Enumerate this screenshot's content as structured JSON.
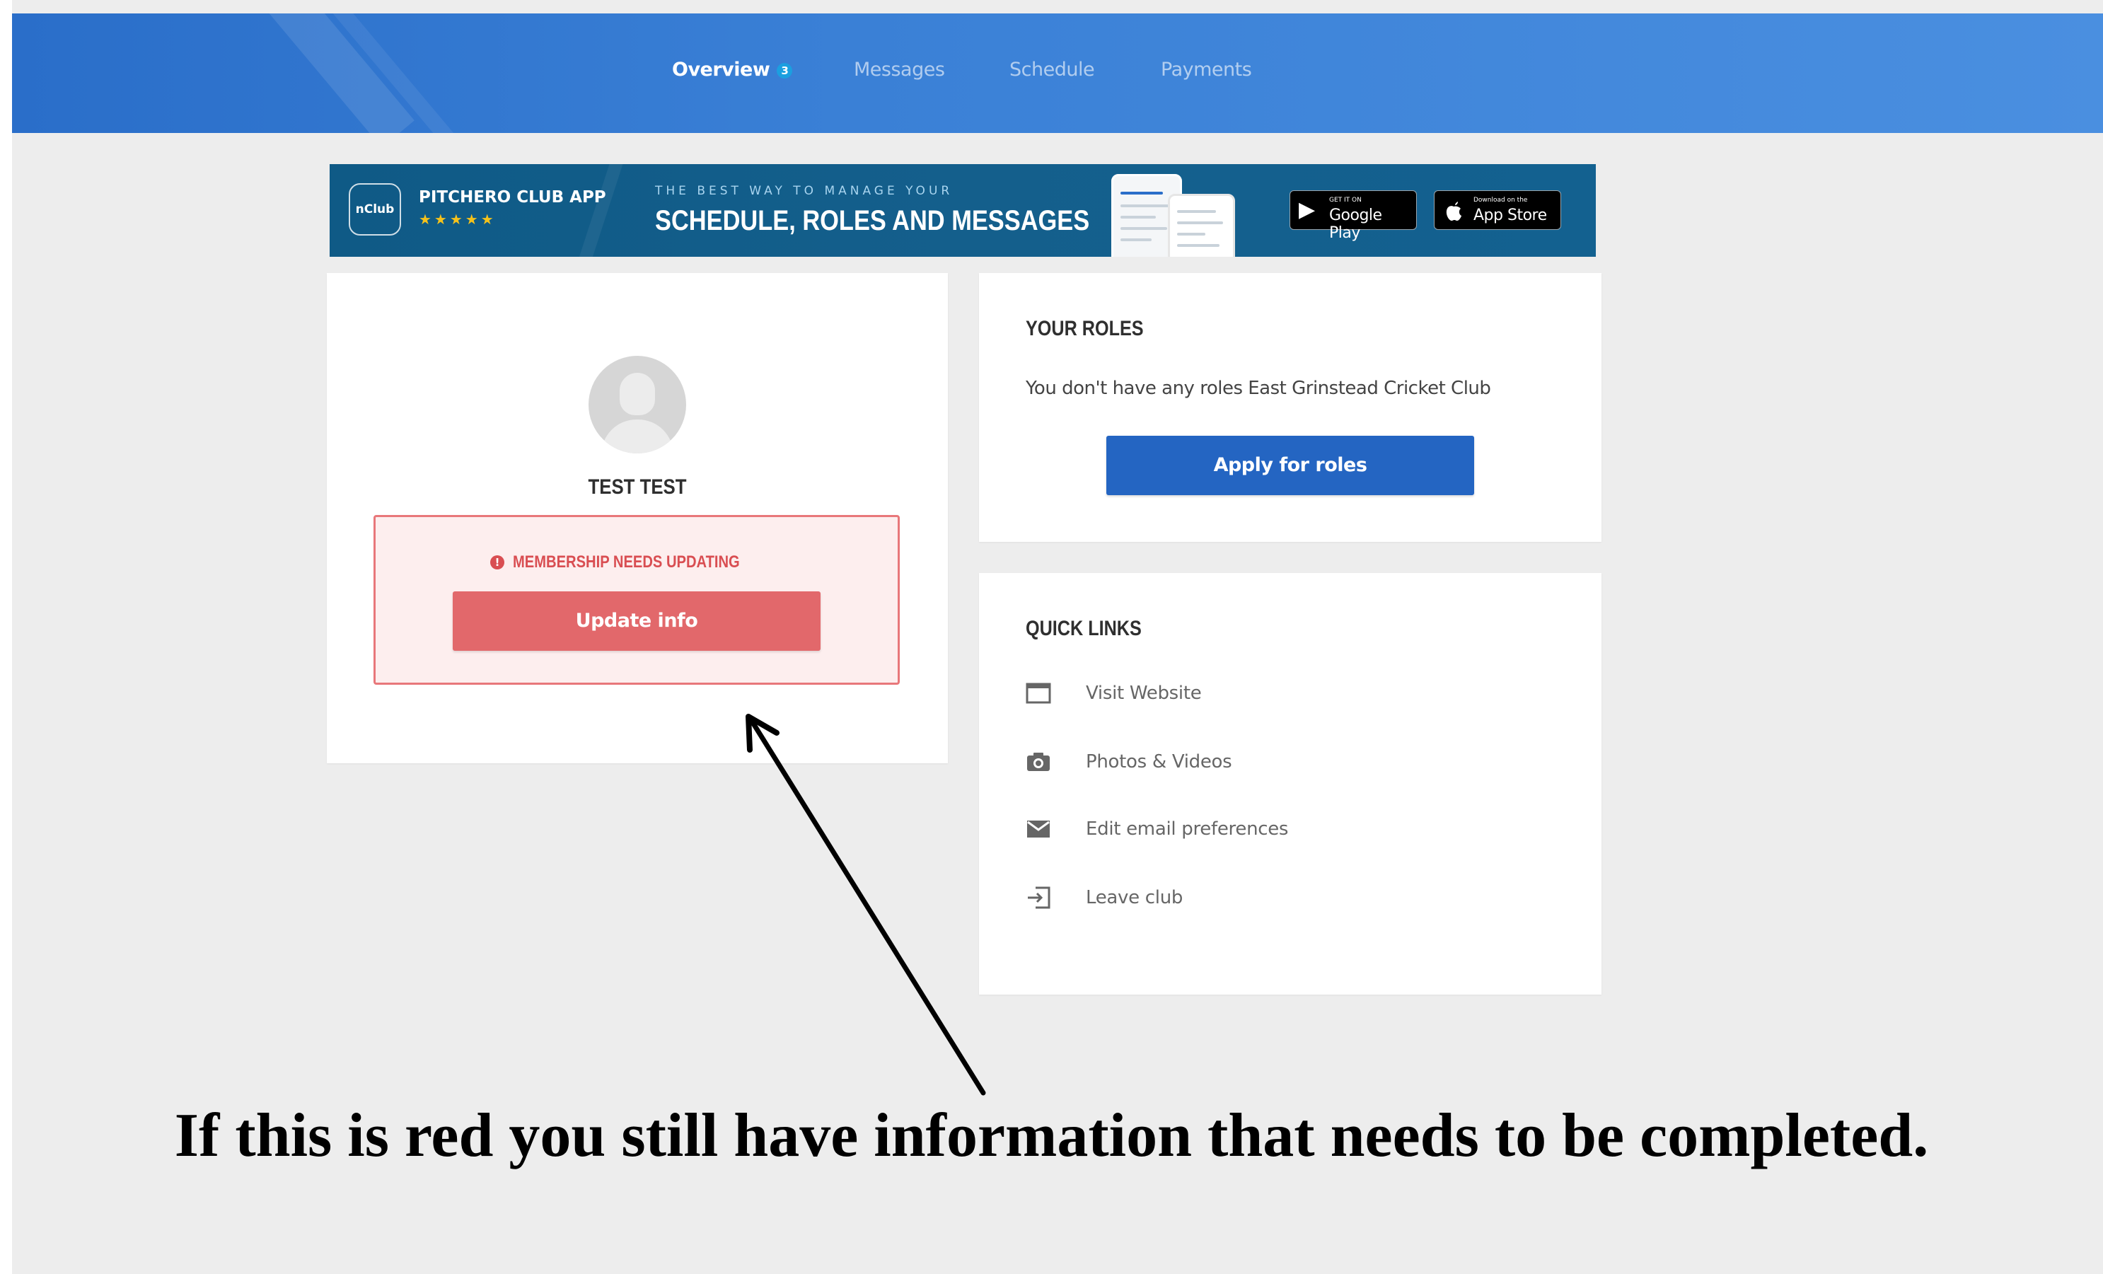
{
  "nav": {
    "items": [
      {
        "label": "Overview",
        "badge": "3",
        "active": true
      },
      {
        "label": "Messages"
      },
      {
        "label": "Schedule"
      },
      {
        "label": "Payments"
      }
    ]
  },
  "banner": {
    "logo_text": "nClub",
    "app_name": "PITCHERO CLUB APP",
    "stars": "★★★★★",
    "kicker": "THE BEST WAY TO MANAGE YOUR",
    "headline": "SCHEDULE, ROLES AND MESSAGES",
    "google_small": "GET IT ON",
    "google_big": "Google Play",
    "apple_small": "Download on the",
    "apple_big": "App Store"
  },
  "profile": {
    "name": "TEST TEST",
    "alert_icon": "!",
    "alert_text": "MEMBERSHIP NEEDS UPDATING",
    "update_label": "Update info"
  },
  "roles": {
    "title": "YOUR ROLES",
    "text": "You don't have any roles East Grinstead Cricket Club",
    "apply_label": "Apply for roles"
  },
  "quick_links": {
    "title": "QUICK LINKS",
    "items": [
      {
        "label": "Visit Website",
        "icon": "browser-window-icon"
      },
      {
        "label": "Photos & Videos",
        "icon": "camera-icon"
      },
      {
        "label": "Edit email preferences",
        "icon": "envelope-icon"
      },
      {
        "label": "Leave club",
        "icon": "exit-icon"
      }
    ]
  },
  "annotation": {
    "caption": "If this is red you still have information that needs to be completed."
  },
  "colors": {
    "header_blue": "#3a80d6",
    "banner_teal": "#145f8c",
    "alert_red": "#e2686b",
    "primary_blue": "#2465c2"
  }
}
